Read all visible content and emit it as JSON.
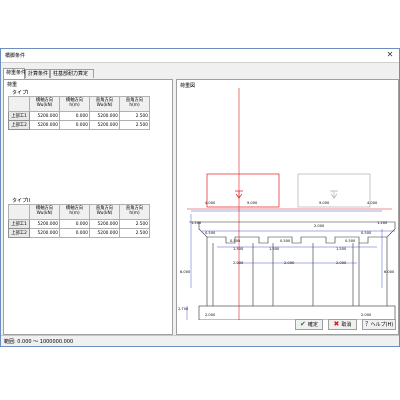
{
  "window": {
    "title": "橋脚条件",
    "close_glyph": "✕"
  },
  "tabs": [
    {
      "label": "荷重条件"
    },
    {
      "label": "計算条件"
    },
    {
      "label": "柱基部耐力算定"
    }
  ],
  "left": {
    "load_group": "荷重",
    "type1": {
      "label": "タイプI",
      "headers": [
        [
          "橋軸方向",
          "Wu(kN)"
        ],
        [
          "橋軸方向",
          "h(m)"
        ],
        [
          "直角方向",
          "Wu(kN)"
        ],
        [
          "直角方向",
          "h(m)"
        ]
      ],
      "rows": [
        {
          "name": "上部工1",
          "values": [
            "5200.000",
            "0.000",
            "5200.000",
            "2.500"
          ]
        },
        {
          "name": "上部工2",
          "values": [
            "5200.000",
            "0.000",
            "5200.000",
            "2.500"
          ]
        }
      ]
    },
    "type2": {
      "label": "タイプII",
      "headers": [
        [
          "橋軸方向",
          "Wu(kN)"
        ],
        [
          "橋軸方向",
          "h(m)"
        ],
        [
          "直角方向",
          "Wu(kN)"
        ],
        [
          "直角方向",
          "h(m)"
        ]
      ],
      "rows": [
        {
          "name": "上部工1",
          "values": [
            "5200.000",
            "0.000",
            "5200.000",
            "2.500"
          ]
        },
        {
          "name": "上部工2",
          "values": [
            "5200.000",
            "0.000",
            "5200.000",
            "2.500"
          ]
        }
      ]
    }
  },
  "diagram": {
    "label": "荷重図",
    "dims": {
      "top_left": "4.000",
      "top_red": "9.000",
      "top_gray": "9.000",
      "top_right": "4.000",
      "h_left": "1.200",
      "h_right": "1.200",
      "beam_left": "0.500",
      "beam_mid": "2.000",
      "beam_right": "0.500",
      "col_w1": "0.500",
      "col_w2": "1.500",
      "col_w3": "1.500",
      "col_w4": "0.500",
      "col_w5": "1.500",
      "col_w6": "0.500",
      "col_h_left": "6.000",
      "col_h_right": "6.000",
      "inner_l": "2.000",
      "inner_m": "2.000",
      "inner_r": "2.000",
      "footing_h": "2.700",
      "footing_l": "2.000",
      "footing_r": "2.000"
    }
  },
  "buttons": {
    "ok": {
      "label": "確定",
      "icon": "✔"
    },
    "cancel": {
      "label": "取消",
      "icon": "✖"
    },
    "help": {
      "label": "ヘルプ(H)",
      "icon": "?"
    }
  },
  "status": {
    "range": "範囲: 0.000 ～ 1000000.000"
  },
  "colors": {
    "red_box": "#e02020",
    "dim_blue": "#2030c0",
    "axis_red": "#e02020",
    "frame": "#303030"
  }
}
